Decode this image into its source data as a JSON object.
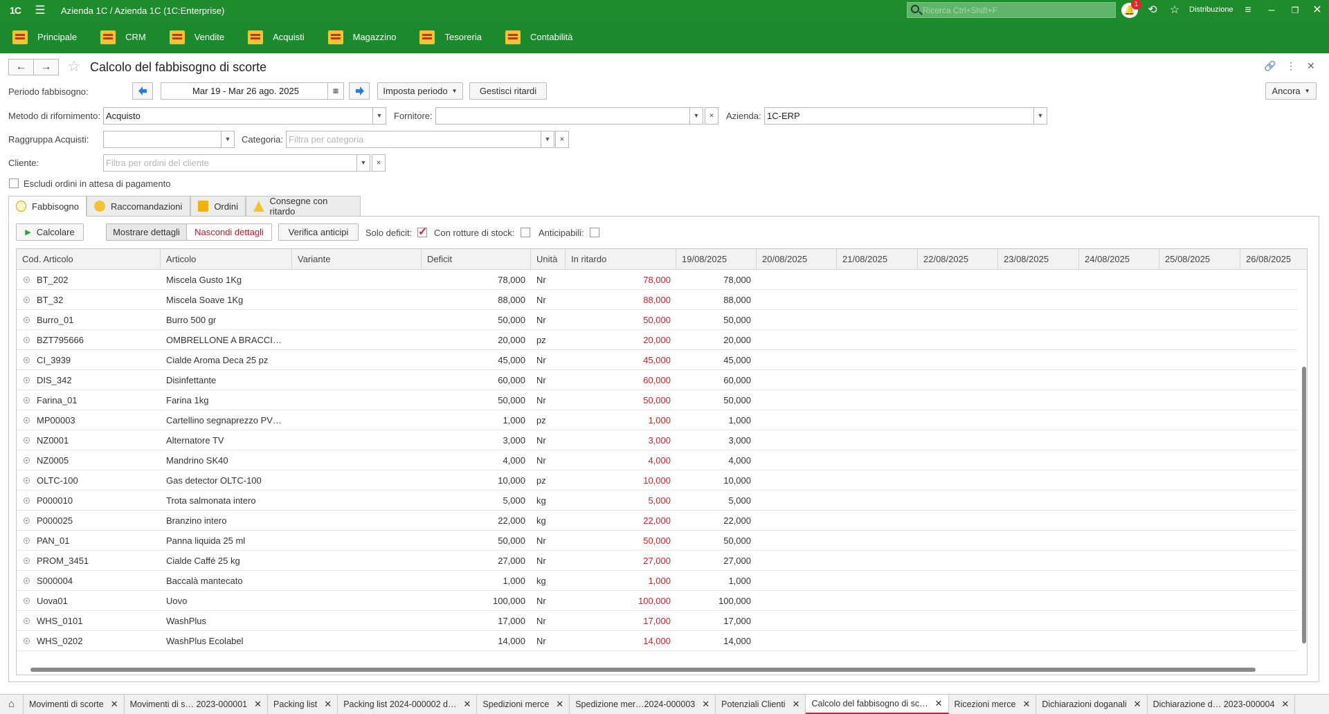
{
  "app": {
    "logo": "1C",
    "title": "Azienda 1C / Azienda 1C  (1C:Enterprise)",
    "search_placeholder": "Ricerca Ctrl+Shift+F",
    "notification_count": "1",
    "user": "Distribuzione"
  },
  "sections": [
    {
      "label": "Principale",
      "icon": "home-section-icon"
    },
    {
      "label": "CRM",
      "icon": "crm-section-icon"
    },
    {
      "label": "Vendite",
      "icon": "sales-section-icon"
    },
    {
      "label": "Acquisti",
      "icon": "purchases-section-icon"
    },
    {
      "label": "Magazzino",
      "icon": "warehouse-section-icon"
    },
    {
      "label": "Tesoreria",
      "icon": "treasury-section-icon"
    },
    {
      "label": "Contabilità",
      "icon": "accounting-section-icon"
    }
  ],
  "form": {
    "title": "Calcolo del fabbisogno di scorte",
    "more_button": "Ancora",
    "period_label": "Periodo fabbisogno:",
    "period_value": "Mar 19 - Mar 26 ago. 2025",
    "set_period_button": "Imposta periodo",
    "manage_delays_button": "Gestisci ritardi",
    "method_label": "Metodo di rifornimento:",
    "method_value": "Acquisto",
    "supplier_label": "Fornitore:",
    "supplier_value": "",
    "company_label": "Azienda:",
    "company_value": "1C-ERP",
    "group_label": "Raggruppa Acquisti:",
    "group_value": "",
    "category_label": "Categoria:",
    "category_placeholder": "Filtra per categoria",
    "customer_label": "Cliente:",
    "customer_placeholder": "Filtra per ordini del cliente",
    "exclude_label": "Escludi ordini in attesa di pagamento"
  },
  "tabs": [
    {
      "label": "Fabbisogno",
      "active": true
    },
    {
      "label": "Raccomandazioni",
      "active": false
    },
    {
      "label": "Ordini",
      "active": false
    },
    {
      "label": "Consegne con ritardo",
      "active": false
    }
  ],
  "toolbar": {
    "calculate": "Calcolare",
    "show_details": "Mostrare dettagli",
    "hide_details": "Nascondi dettagli",
    "check_advances": "Verifica anticipi",
    "only_deficit": "Solo deficit:",
    "only_deficit_checked": true,
    "stockouts": "Con rotture di stock:",
    "stockouts_checked": false,
    "advances": "Anticipabili:",
    "advances_checked": false
  },
  "grid": {
    "columns": [
      "Cod. Articolo",
      "Articolo",
      "Variante",
      "Deficit",
      "Unità",
      "In ritardo",
      "19/08/2025",
      "20/08/2025",
      "21/08/2025",
      "22/08/2025",
      "23/08/2025",
      "24/08/2025",
      "25/08/2025",
      "26/08/2025"
    ],
    "rows": [
      {
        "code": "BT_202",
        "item": "Miscela Gusto 1Kg",
        "variant": "",
        "deficit": "78,000",
        "unit": "Nr",
        "late": "78,000",
        "d19": "78,000"
      },
      {
        "code": "BT_32",
        "item": "Miscela Soave 1Kg",
        "variant": "",
        "deficit": "88,000",
        "unit": "Nr",
        "late": "88,000",
        "d19": "88,000"
      },
      {
        "code": "Burro_01",
        "item": "Burro 500 gr",
        "variant": "",
        "deficit": "50,000",
        "unit": "Nr",
        "late": "50,000",
        "d19": "50,000"
      },
      {
        "code": "BZT795666",
        "item": "OMBRELLONE A BRACCI…",
        "variant": "",
        "deficit": "20,000",
        "unit": "pz",
        "late": "20,000",
        "d19": "20,000"
      },
      {
        "code": "CI_3939",
        "item": "Cialde Aroma Deca 25 pz",
        "variant": "",
        "deficit": "45,000",
        "unit": "Nr",
        "late": "45,000",
        "d19": "45,000"
      },
      {
        "code": "DIS_342",
        "item": "Disinfettante",
        "variant": "",
        "deficit": "60,000",
        "unit": "Nr",
        "late": "60,000",
        "d19": "60,000"
      },
      {
        "code": "Farina_01",
        "item": "Farina 1kg",
        "variant": "",
        "deficit": "50,000",
        "unit": "Nr",
        "late": "50,000",
        "d19": "50,000"
      },
      {
        "code": "MP00003",
        "item": "Cartellino segnaprezzo PV…",
        "variant": "",
        "deficit": "1,000",
        "unit": "pz",
        "late": "1,000",
        "d19": "1,000"
      },
      {
        "code": "NZ0001",
        "item": "Alternatore TV",
        "variant": "",
        "deficit": "3,000",
        "unit": "Nr",
        "late": "3,000",
        "d19": "3,000"
      },
      {
        "code": "NZ0005",
        "item": "Mandrino SK40",
        "variant": "",
        "deficit": "4,000",
        "unit": "Nr",
        "late": "4,000",
        "d19": "4,000"
      },
      {
        "code": "OLTC-100",
        "item": "Gas detector OLTC-100",
        "variant": "",
        "deficit": "10,000",
        "unit": "pz",
        "late": "10,000",
        "d19": "10,000"
      },
      {
        "code": "P000010",
        "item": "Trota salmonata intero",
        "variant": "",
        "deficit": "5,000",
        "unit": "kg",
        "late": "5,000",
        "d19": "5,000"
      },
      {
        "code": "P000025",
        "item": "Branzino intero",
        "variant": "",
        "deficit": "22,000",
        "unit": "kg",
        "late": "22,000",
        "d19": "22,000"
      },
      {
        "code": "PAN_01",
        "item": "Panna liquida 25 ml",
        "variant": "",
        "deficit": "50,000",
        "unit": "Nr",
        "late": "50,000",
        "d19": "50,000"
      },
      {
        "code": "PROM_3451",
        "item": "Cialde Caffé 25 kg",
        "variant": "",
        "deficit": "27,000",
        "unit": "Nr",
        "late": "27,000",
        "d19": "27,000"
      },
      {
        "code": "S000004",
        "item": "Baccalà mantecato",
        "variant": "",
        "deficit": "1,000",
        "unit": "kg",
        "late": "1,000",
        "d19": "1,000"
      },
      {
        "code": "Uova01",
        "item": "Uovo",
        "variant": "",
        "deficit": "100,000",
        "unit": "Nr",
        "late": "100,000",
        "d19": "100,000"
      },
      {
        "code": "WHS_0101",
        "item": "WashPlus",
        "variant": "",
        "deficit": "17,000",
        "unit": "Nr",
        "late": "17,000",
        "d19": "17,000"
      },
      {
        "code": "WHS_0202",
        "item": "WashPlus Ecolabel",
        "variant": "",
        "deficit": "14,000",
        "unit": "Nr",
        "late": "14,000",
        "d19": "14,000"
      }
    ]
  },
  "taskbar": [
    {
      "label": "Movimenti di scorte",
      "active": false
    },
    {
      "label": "Movimenti di s… 2023-000001",
      "active": false
    },
    {
      "label": "Packing list",
      "active": false
    },
    {
      "label": "Packing list 2024-000002 d…",
      "active": false
    },
    {
      "label": "Spedizioni merce",
      "active": false
    },
    {
      "label": "Spedizione mer…2024-000003",
      "active": false
    },
    {
      "label": "Potenziali Clienti",
      "active": false
    },
    {
      "label": "Calcolo del fabbisogno di sc…",
      "active": true
    },
    {
      "label": "Ricezioni merce",
      "active": false
    },
    {
      "label": "Dichiarazioni doganali",
      "active": false
    },
    {
      "label": "Dichiarazione d… 2023-000004",
      "active": false
    }
  ],
  "colors": {
    "brand_green": "#1e8c2d",
    "late_red": "#d5202a"
  }
}
